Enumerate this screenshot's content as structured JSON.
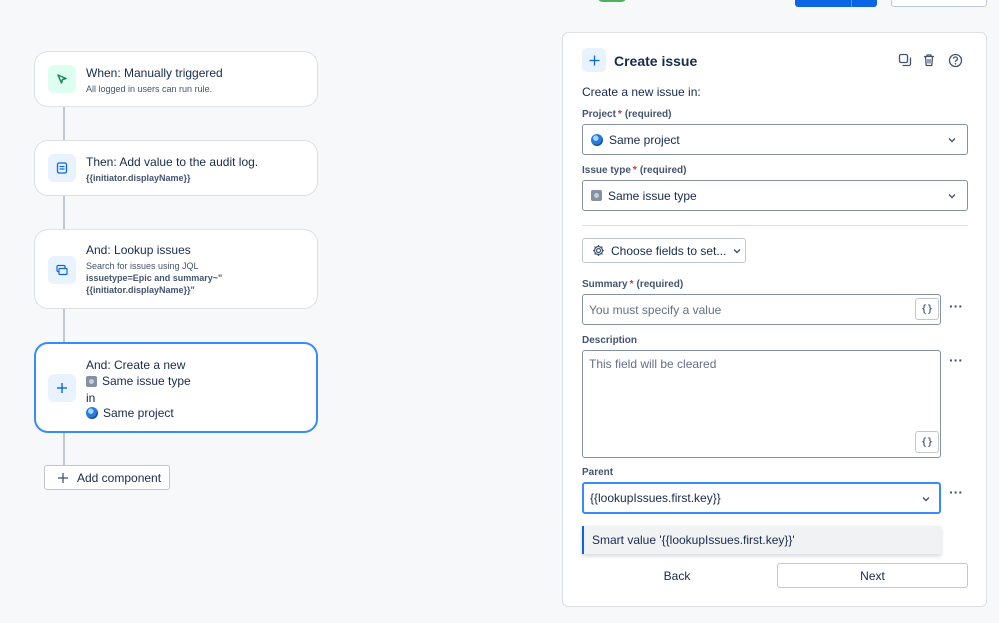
{
  "rule": {
    "trigger": {
      "title": "When: Manually triggered",
      "subtitle": "All logged in users can run rule."
    },
    "audit": {
      "title": "Then: Add value to the audit log.",
      "value": "{{initiator.displayName}}"
    },
    "lookup": {
      "title": "And: Lookup issues",
      "subtitle": "Search for issues using JQL",
      "jql_line1": "issuetype=Epic and summary~\"",
      "jql_line2": "{{initiator.displayName}}\""
    },
    "create": {
      "title": "And: Create a new",
      "issue_type": "Same issue type",
      "in": "in",
      "project": "Same project"
    },
    "add_component": "Add component"
  },
  "panel": {
    "title": "Create issue",
    "intro": "Create a new issue in:",
    "project": {
      "label": "Project",
      "required_mark": "*",
      "required_text": "(required)",
      "value": "Same project"
    },
    "issue_type": {
      "label": "Issue type",
      "required_mark": "*",
      "required_text": "(required)",
      "value": "Same issue type"
    },
    "choose_fields": "Choose fields to set...",
    "summary": {
      "label": "Summary",
      "required_mark": "*",
      "required_text": "(required)",
      "placeholder": "You must specify a value"
    },
    "description": {
      "label": "Description",
      "placeholder": "This field will be cleared"
    },
    "parent": {
      "label": "Parent",
      "value": "{{lookupIssues.first.key}}",
      "suggestion": "Smart value '{{lookupIssues.first.key}}'"
    },
    "braces": "{}",
    "more": "···",
    "back": "Back",
    "next": "Next"
  },
  "icons": {
    "trigger": "cursor-trigger-icon",
    "audit": "audit-log-icon",
    "lookup": "lookup-issues-icon",
    "create": "plus-icon"
  },
  "colors": {
    "accent": "#388bff",
    "primary": "#0c66e4",
    "required": "#c9372c"
  }
}
